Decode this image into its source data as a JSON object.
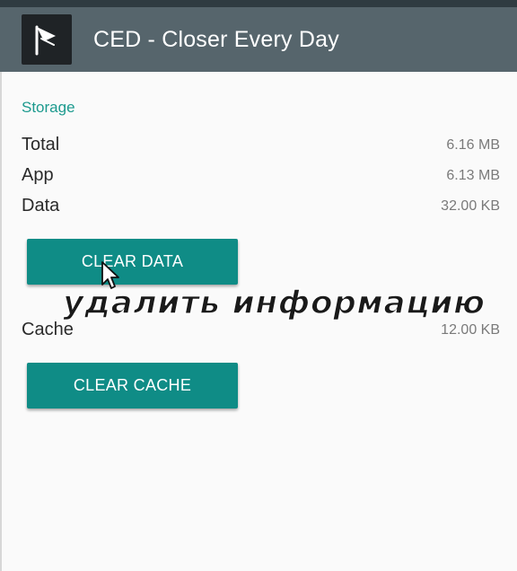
{
  "appbar": {
    "icon": "app-logo-icon",
    "title": "CED - Closer Every Day",
    "color": "#56656c"
  },
  "storage": {
    "section_title": "Storage",
    "rows": [
      {
        "label": "Total",
        "value": "6.16 MB"
      },
      {
        "label": "App",
        "value": "6.13 MB"
      },
      {
        "label": "Data",
        "value": "32.00 KB"
      }
    ],
    "clear_data_label": "CLEAR DATA",
    "cache": {
      "label": "Cache",
      "value": "12.00 KB"
    },
    "clear_cache_label": "CLEAR CACHE"
  },
  "overlay": {
    "caption": "удалить информацию"
  },
  "colors": {
    "accent": "#1c9a8e",
    "button": "#0f8c86"
  }
}
